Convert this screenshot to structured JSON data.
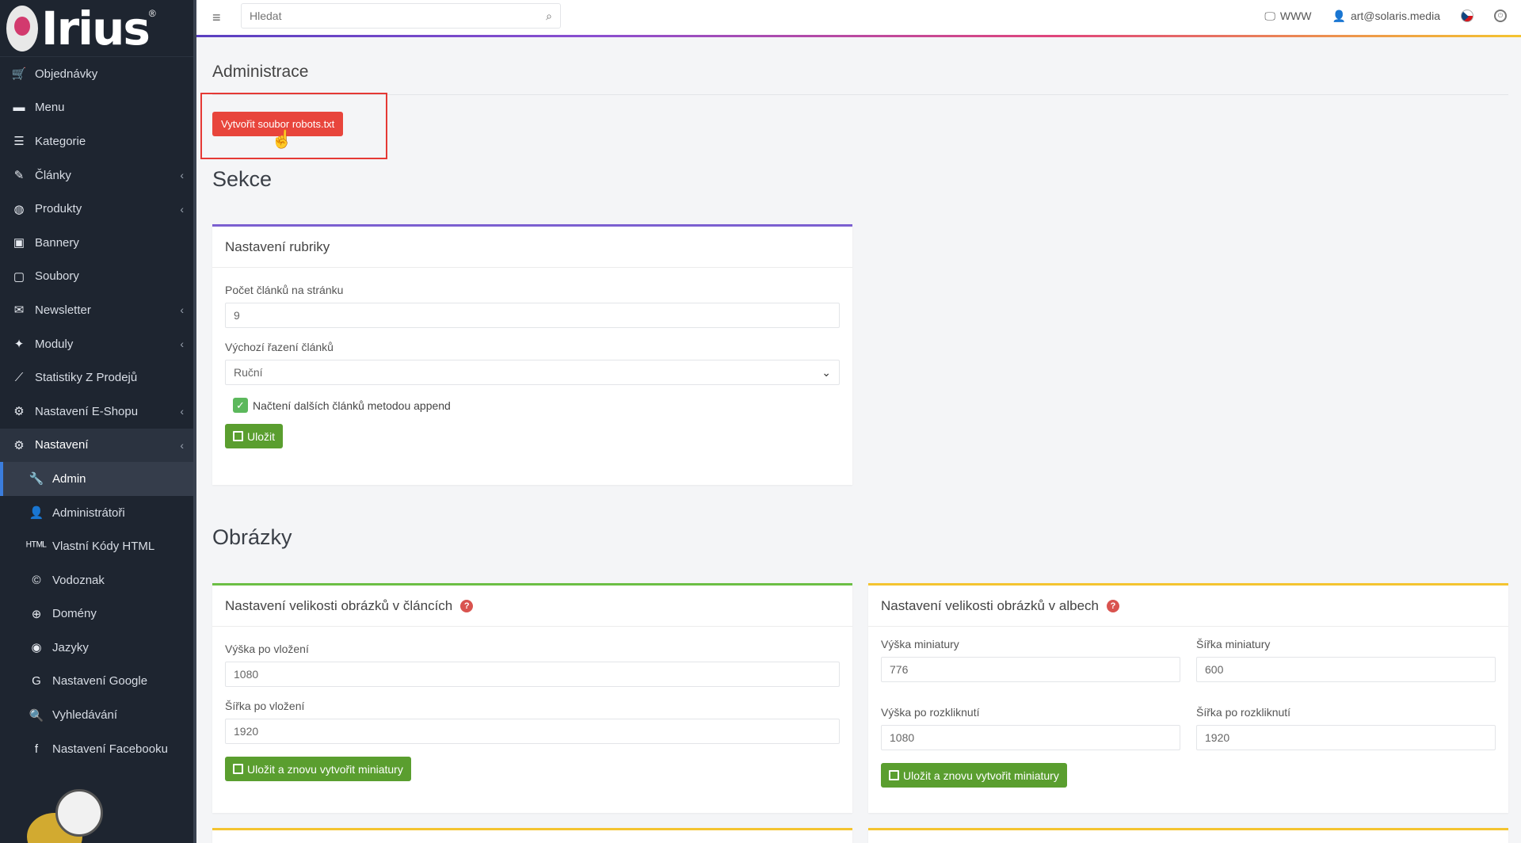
{
  "sidebar": {
    "logo_text": "Irius",
    "logo_reg": "®",
    "items": [
      {
        "label": "Objednávky",
        "icon": "🛒"
      },
      {
        "label": "Menu",
        "icon": "▬"
      },
      {
        "label": "Kategorie",
        "icon": "☰"
      },
      {
        "label": "Články",
        "icon": "✎",
        "chevron": "‹"
      },
      {
        "label": "Produkty",
        "icon": "◍",
        "chevron": "‹"
      },
      {
        "label": "Bannery",
        "icon": "▣"
      },
      {
        "label": "Soubory",
        "icon": "▢"
      },
      {
        "label": "Newsletter",
        "icon": "✉",
        "chevron": "‹"
      },
      {
        "label": "Moduly",
        "icon": "✦",
        "chevron": "‹"
      },
      {
        "label": "Statistiky Z Prodejů",
        "icon": "⟋"
      },
      {
        "label": "Nastavení E-Shopu",
        "icon": "⚙",
        "chevron": "‹"
      },
      {
        "label": "Nastavení",
        "icon": "⚙",
        "chevron": "‹"
      }
    ],
    "sub_items": [
      {
        "label": "Admin",
        "icon": "🔧"
      },
      {
        "label": "Administrátoři",
        "icon": "👤"
      },
      {
        "label": "Vlastní Kódy HTML",
        "icon": "ᴴᵀᴹᴸ"
      },
      {
        "label": "Vodoznak",
        "icon": "©"
      },
      {
        "label": "Domény",
        "icon": "⊕"
      },
      {
        "label": "Jazyky",
        "icon": "◉"
      },
      {
        "label": "Nastavení Google",
        "icon": "G"
      },
      {
        "label": "Vyhledávání",
        "icon": "🔍"
      },
      {
        "label": "Nastavení Facebooku",
        "icon": "f"
      }
    ]
  },
  "topbar": {
    "menu_icon": "≡",
    "search_placeholder": "Hledat",
    "search_icon": "⌕",
    "www_label": "WWW",
    "www_icon": "🖵",
    "user_label": "art@solaris.media",
    "user_icon": "👤",
    "power_icon": "⏻"
  },
  "main": {
    "title": "Administrace",
    "robots_button": "Vytvořit soubor robots.txt",
    "cursor": "☝",
    "section_sekce": "Sekce",
    "section_obrazky": "Obrázky",
    "rubrika_card": {
      "title": "Nastavení rubriky",
      "count_label": "Počet článků na stránku",
      "count_value": "9",
      "order_label": "Výchozí řazení článků",
      "order_value": "Ruční",
      "order_arrow": "⌄",
      "append_label": "Načtení dalších článků metodou append",
      "check_mark": "✓",
      "save_label": "Uložit"
    },
    "clanky_card": {
      "title": "Nastavení velikosti obrázků v článcích",
      "help": "?",
      "height_label": "Výška po vložení",
      "height_value": "1080",
      "width_label": "Šířka po vložení",
      "width_value": "1920",
      "save_label": "Uložit a znovu vytvořit miniatury"
    },
    "albech_card": {
      "title": "Nastavení velikosti obrázků v albech",
      "help": "?",
      "thumb_height_label": "Výška miniatury",
      "thumb_height_value": "776",
      "thumb_width_label": "Šířka miniatury",
      "thumb_width_value": "600",
      "open_height_label": "Výška po rozkliknutí",
      "open_height_value": "1080",
      "open_width_label": "Šířka po rozkliknutí",
      "open_width_value": "1920",
      "save_label": "Uložit a znovu vytvořit miniatury"
    }
  },
  "colors": {
    "sidebar_bg": "#1e2530",
    "danger": "#e8453c",
    "success": "#5a9e2f",
    "accent_purple": "#7b5fd0",
    "accent_green": "#6cbf45",
    "accent_yellow": "#f4c430"
  }
}
